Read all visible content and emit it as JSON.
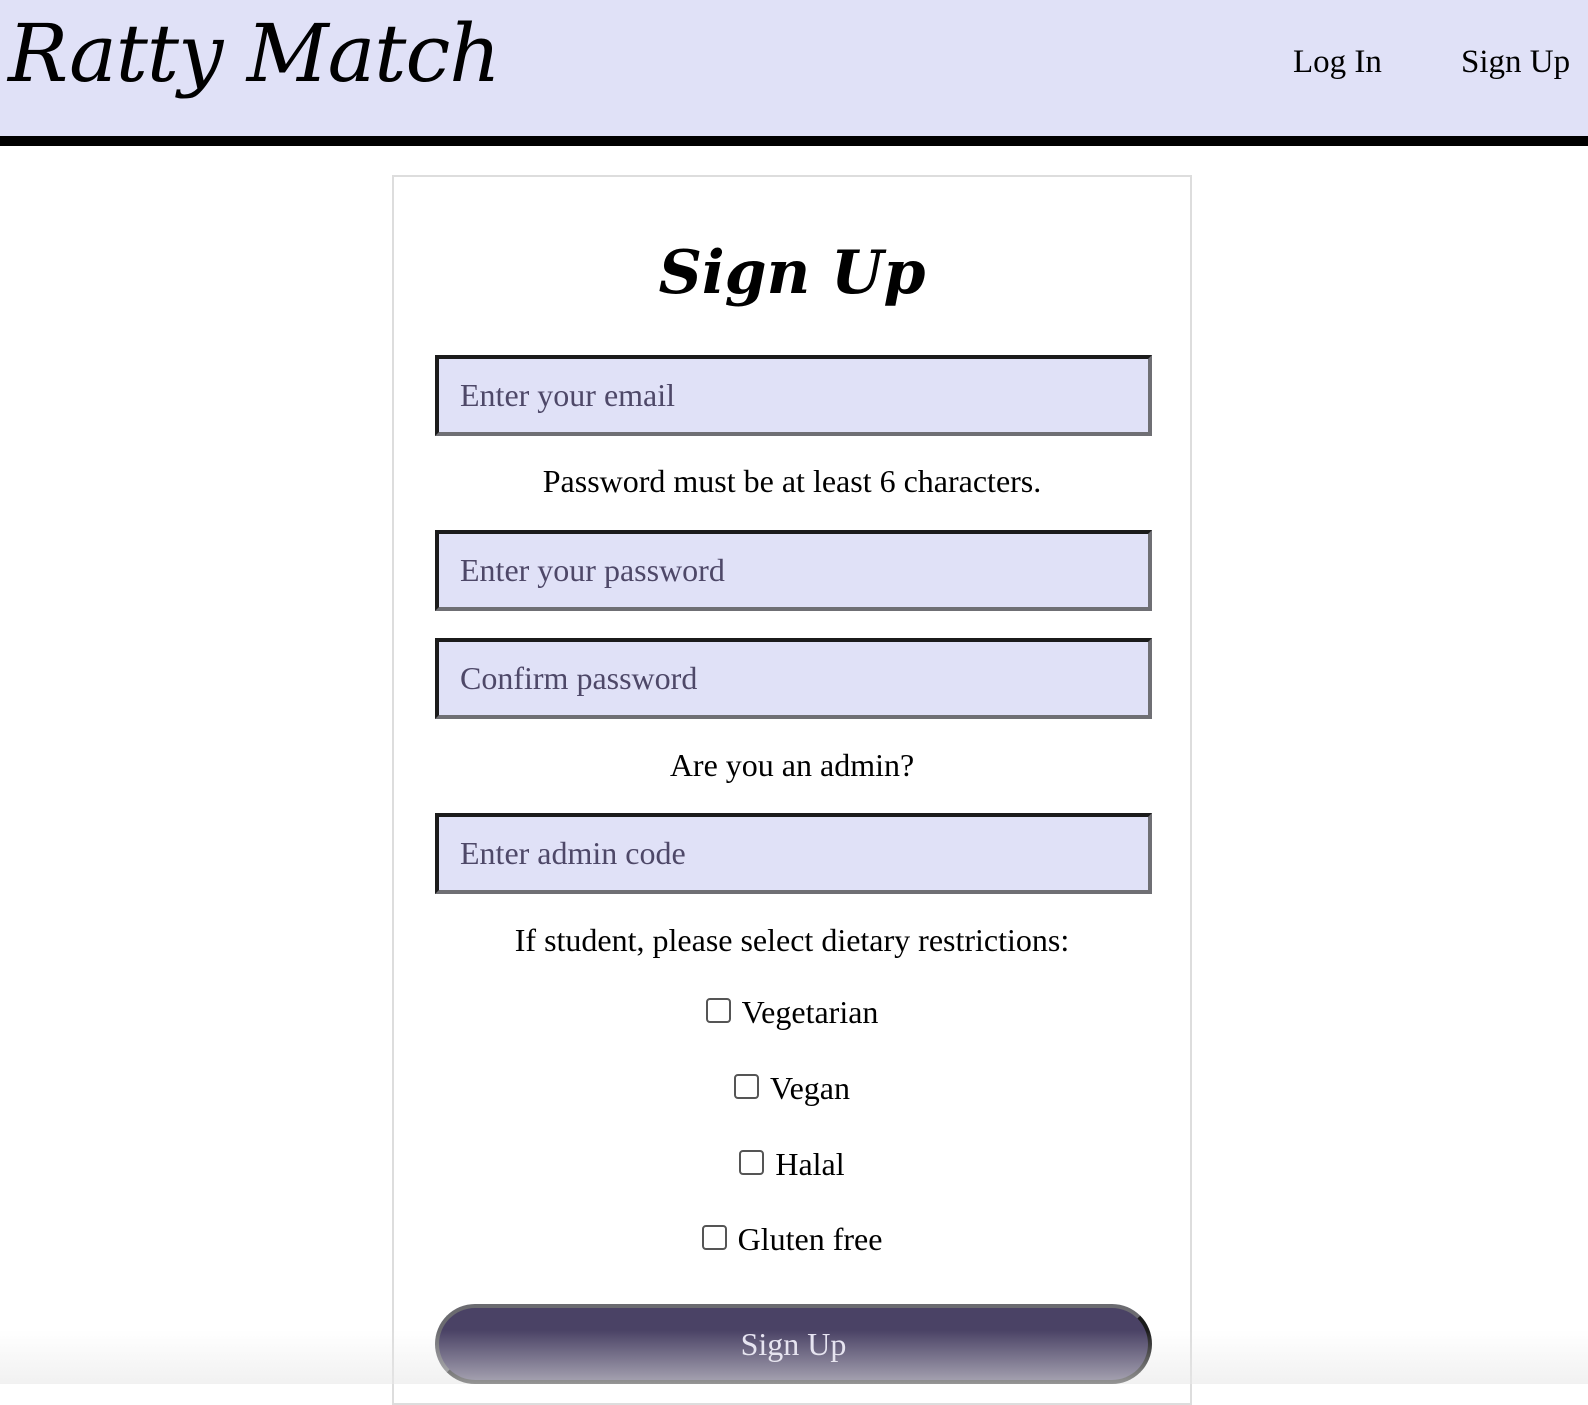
{
  "navbar": {
    "brand": "Ratty Match",
    "links": [
      {
        "label": "Log In"
      },
      {
        "label": "Sign Up"
      }
    ]
  },
  "form": {
    "title": "Sign Up",
    "email": {
      "placeholder": "Enter your email",
      "value": ""
    },
    "password_hint": "Password must be at least 6 characters.",
    "password": {
      "placeholder": "Enter your password",
      "value": ""
    },
    "confirm_password": {
      "placeholder": "Confirm password",
      "value": ""
    },
    "admin_prompt": "Are you an admin?",
    "admin_code": {
      "placeholder": "Enter admin code",
      "value": ""
    },
    "dietary_prompt": "If student, please select dietary restrictions:",
    "dietary_options": [
      {
        "label": "Vegetarian",
        "checked": false
      },
      {
        "label": "Vegan",
        "checked": false
      },
      {
        "label": "Halal",
        "checked": false
      },
      {
        "label": "Gluten free",
        "checked": false
      }
    ],
    "submit_label": "Sign Up"
  },
  "colors": {
    "navbar_bg": "#e0e1f7",
    "input_bg": "#e0e1f7",
    "button_bg": "#4a4265",
    "button_text": "#e6e3f2"
  }
}
